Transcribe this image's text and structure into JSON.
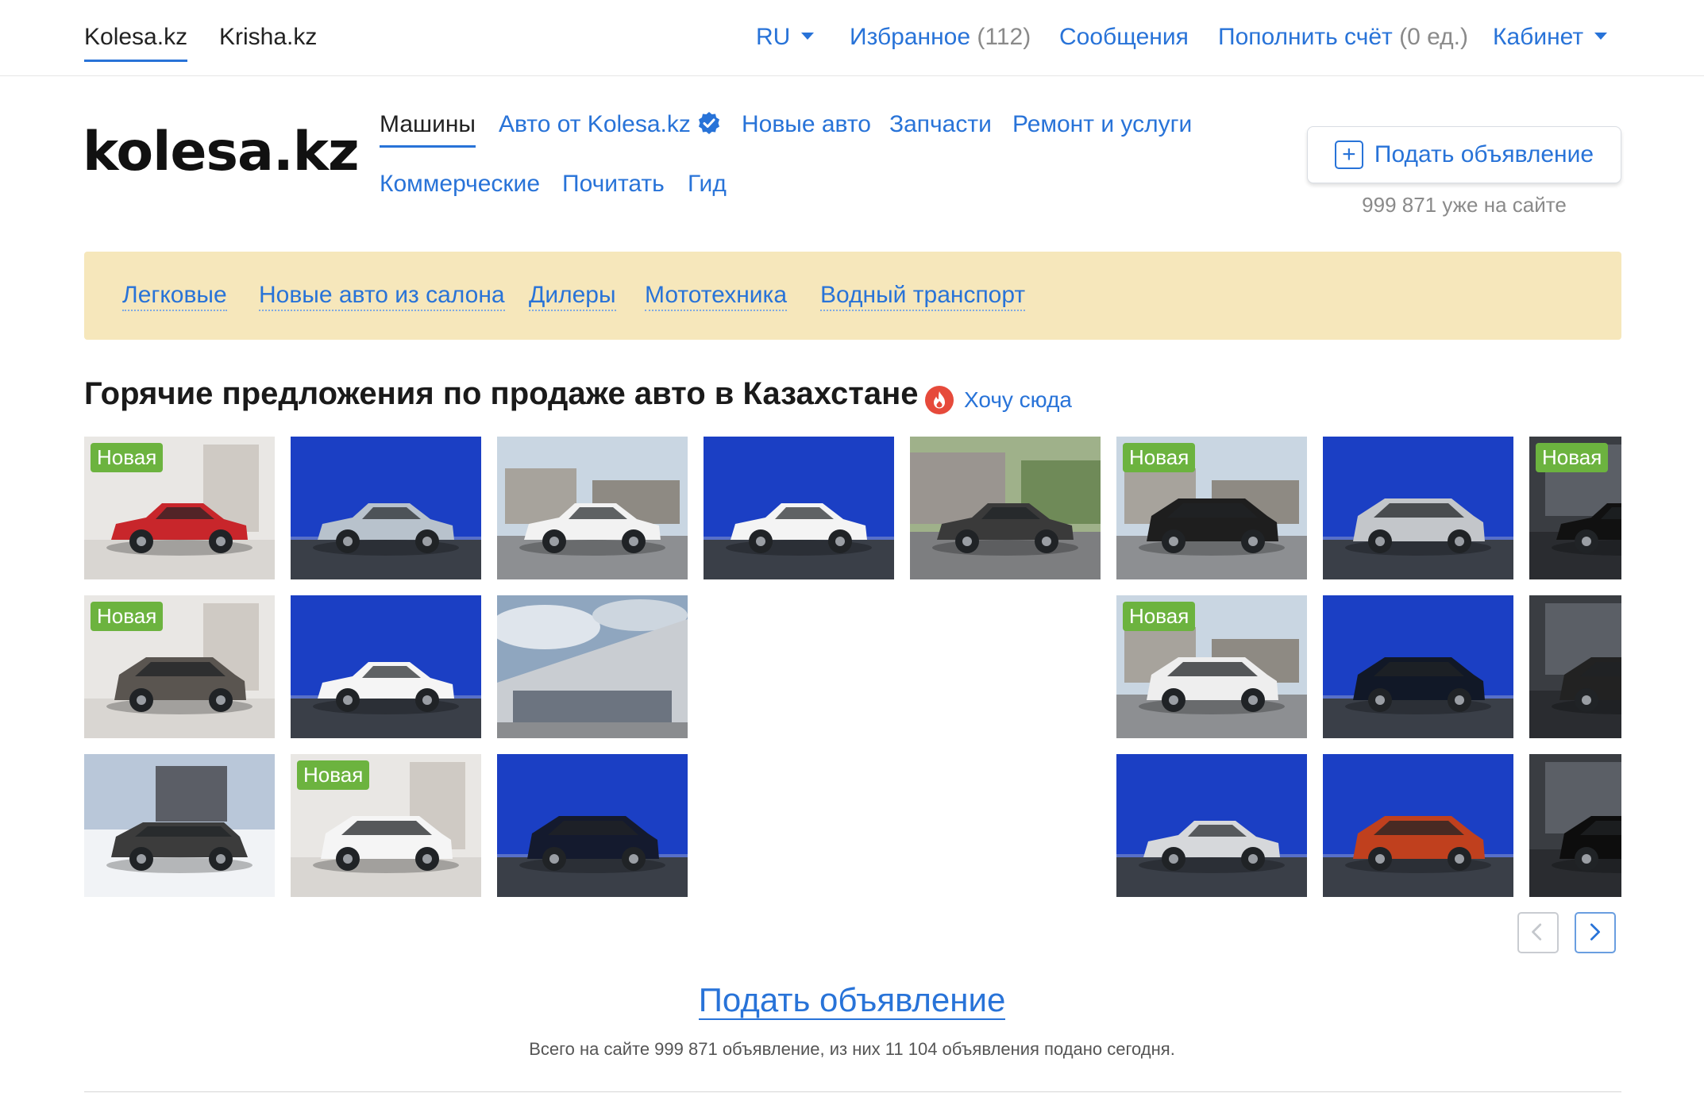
{
  "top": {
    "sites": [
      "Kolesa.kz",
      "Krisha.kz"
    ],
    "lang": "RU",
    "favorites_label": "Избранное",
    "favorites_count": "(112)",
    "messages": "Сообщения",
    "topup_label": "Пополнить счёт",
    "topup_units": "(0 ед.)",
    "cabinet": "Кабинет"
  },
  "header": {
    "logo": "kolesa.kz",
    "nav_row1": [
      "Машины",
      "Авто от Kolesa.kz",
      "Новые авто",
      "Запчасти",
      "Ремонт и услуги"
    ],
    "nav_row2": [
      "Коммерческие",
      "Почитать",
      "Гид"
    ],
    "post_button": "Подать объявление",
    "post_count": "999 871 уже на сайте"
  },
  "categories": [
    "Легковые",
    "Новые авто из салона",
    "Дилеры",
    "Мототехника",
    "Водный транспорт"
  ],
  "hot": {
    "title": "Горячие предложения по продаже авто в Казахстане",
    "want_here": "Хочу сюда",
    "badge_label": "Новая",
    "tiles": [
      {
        "row": 0,
        "col": 0,
        "bg": "studio",
        "car": "#c8262b",
        "kind": "sedan",
        "badge": true
      },
      {
        "row": 0,
        "col": 1,
        "bg": "blue",
        "car": "#b8c2cc",
        "kind": "sedan",
        "badge": false
      },
      {
        "row": 0,
        "col": 2,
        "bg": "street",
        "car": "#f2f2f2",
        "kind": "sedan",
        "badge": false
      },
      {
        "row": 0,
        "col": 3,
        "bg": "blue",
        "car": "#f4f4f4",
        "kind": "sedan",
        "badge": false
      },
      {
        "row": 0,
        "col": 4,
        "bg": "yard",
        "car": "#3a3a3a",
        "kind": "sedan",
        "badge": false
      },
      {
        "row": 0,
        "col": 5,
        "bg": "street",
        "car": "#1e1e1e",
        "kind": "suv",
        "badge": true
      },
      {
        "row": 0,
        "col": 6,
        "bg": "blue",
        "car": "#c3c6ca",
        "kind": "suv",
        "badge": false
      },
      {
        "row": 0,
        "col": 7,
        "bg": "showroom",
        "car": "#111111",
        "kind": "sedan",
        "badge": true
      },
      {
        "row": 1,
        "col": 0,
        "bg": "studio",
        "car": "#5a5550",
        "kind": "suv",
        "badge": true
      },
      {
        "row": 1,
        "col": 1,
        "bg": "blue",
        "car": "#f5f5f5",
        "kind": "sedan",
        "badge": false
      },
      {
        "row": 1,
        "col": 2,
        "bg": "building",
        "car": "#eeeeee",
        "kind": "none",
        "badge": false
      },
      {
        "row": 1,
        "col": 5,
        "bg": "street",
        "car": "#eeeeee",
        "kind": "suv",
        "badge": true
      },
      {
        "row": 1,
        "col": 6,
        "bg": "blue",
        "car": "#111827",
        "kind": "suv",
        "badge": false
      },
      {
        "row": 1,
        "col": 7,
        "bg": "showroom",
        "car": "#222222",
        "kind": "suv",
        "badge": false
      },
      {
        "row": 2,
        "col": 0,
        "bg": "snow",
        "car": "#3c3c3c",
        "kind": "wagon",
        "badge": false
      },
      {
        "row": 2,
        "col": 1,
        "bg": "studio",
        "car": "#f5f5f5",
        "kind": "suv",
        "badge": true
      },
      {
        "row": 2,
        "col": 2,
        "bg": "blue",
        "car": "#141a2e",
        "kind": "suv",
        "badge": false
      },
      {
        "row": 2,
        "col": 5,
        "bg": "blue",
        "car": "#d6d8db",
        "kind": "sedan",
        "badge": false
      },
      {
        "row": 2,
        "col": 6,
        "bg": "blue",
        "car": "#c0401e",
        "kind": "suv",
        "badge": false
      },
      {
        "row": 2,
        "col": 7,
        "bg": "showroom",
        "car": "#0d0d0d",
        "kind": "suv",
        "badge": false
      }
    ]
  },
  "footer": {
    "post_link": "Подать объявление",
    "totals": "Всего на сайте 999 871 объявление, из них 11 104 объявления подано сегодня."
  },
  "colors": {
    "link": "#2873d8",
    "badge": "#6cb33f",
    "category_bg": "#f6e7bb",
    "fire": "#e64a3b"
  },
  "icons": [
    "caret-down-icon",
    "verified-badge-icon",
    "plus-box-icon",
    "fire-icon",
    "arrow-left-icon",
    "arrow-right-icon"
  ]
}
